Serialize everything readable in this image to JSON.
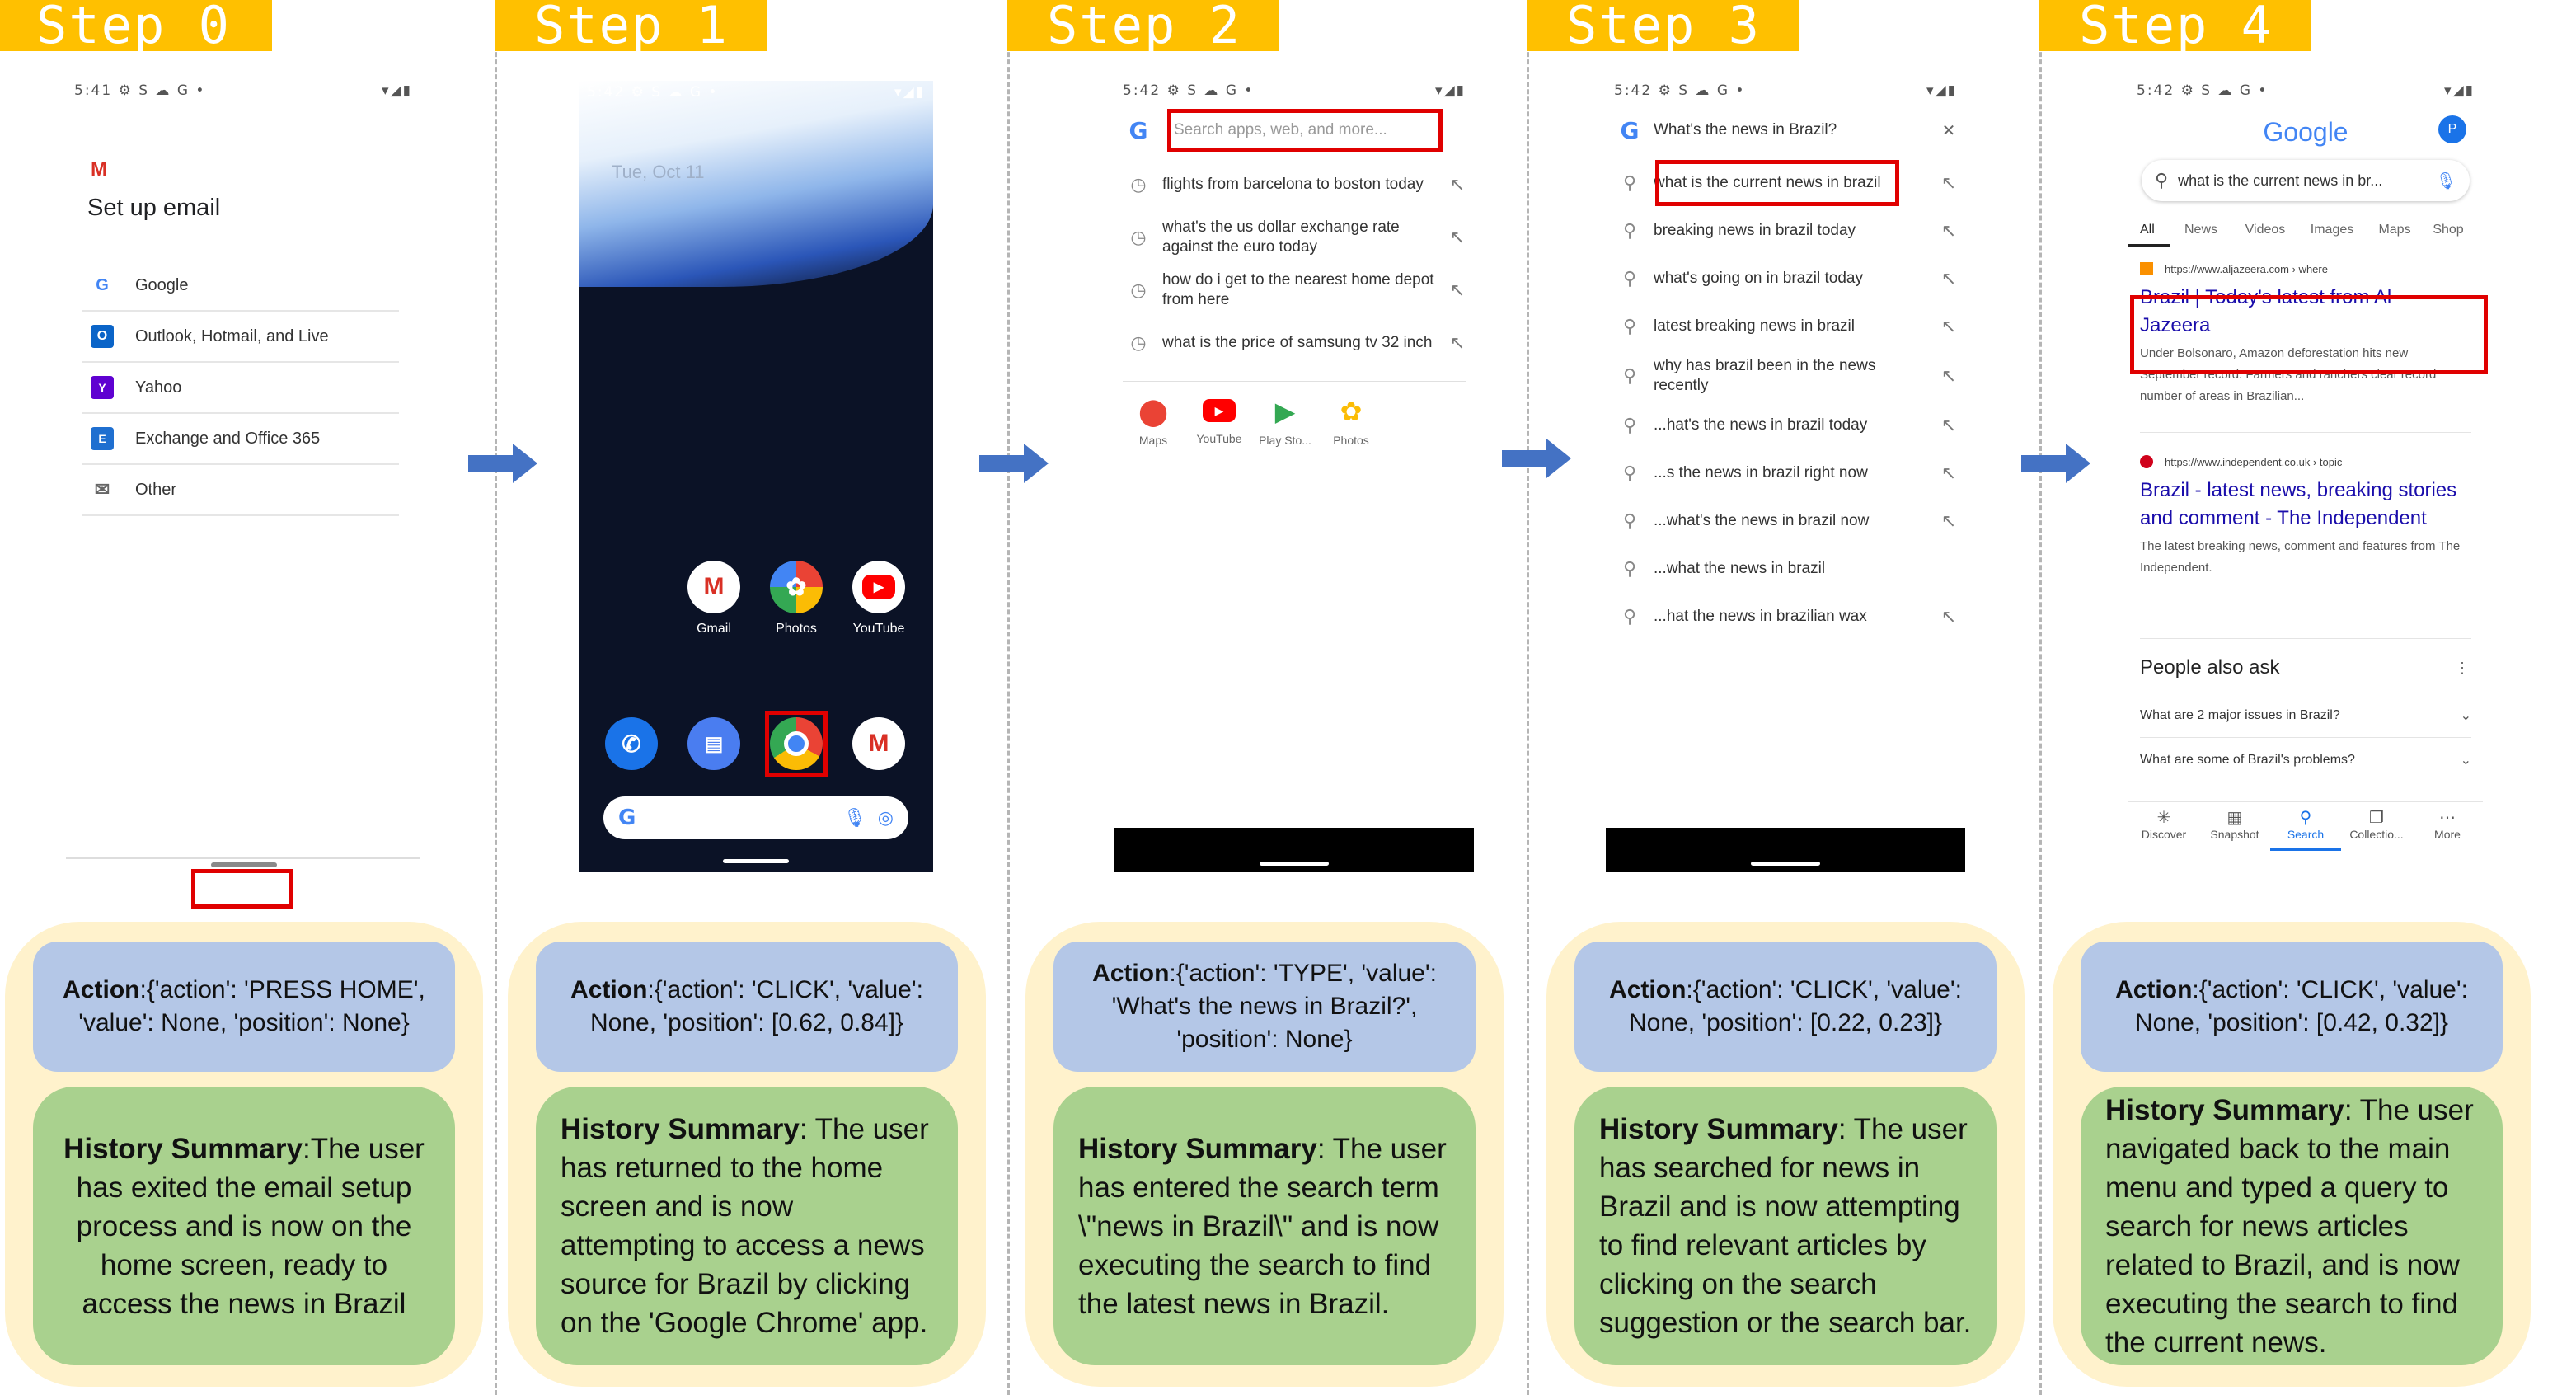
{
  "steps": [
    {
      "label": "Step 0",
      "action_label": "Action",
      "action_value": ":{'action': 'PRESS HOME', 'value': None, 'position': None}",
      "summary_label": "History Summary",
      "summary_value": ":The user has exited the email setup process and is now on the home screen, ready to access the news in Brazil"
    },
    {
      "label": "Step 1",
      "action_label": "Action",
      "action_value": ":{'action': 'CLICK', 'value': None, 'position': [0.62, 0.84]}",
      "summary_label": "History Summary",
      "summary_value": ": The user has returned to the home screen and is now attempting to access a news source for Brazil by clicking on the 'Google Chrome' app."
    },
    {
      "label": "Step 2",
      "action_label": "Action",
      "action_value": ":{'action': 'TYPE', 'value': 'What's the news in Brazil?', 'position': None}",
      "summary_label": "History Summary",
      "summary_value": ": The user has entered the search term \\\"news in Brazil\\\" and is now executing the search to find the latest news in Brazil."
    },
    {
      "label": "Step 3",
      "action_label": "Action",
      "action_value": ":{'action': 'CLICK', 'value': None, 'position': [0.22, 0.23]}",
      "summary_label": "History Summary",
      "summary_value": ": The user has searched for news in Brazil and is now attempting to find relevant articles by clicking on the search suggestion or the search bar."
    },
    {
      "label": "Step 4",
      "action_label": "Action",
      "action_value": ":{'action': 'CLICK', 'value': None, 'position': [0.42, 0.32]}",
      "summary_label": "History Summary",
      "summary_value": ": The user navigated back to the main menu and typed a query to search for news articles related to Brazil, and is now executing the search to find the current news."
    }
  ],
  "screen0": {
    "time": "5:41",
    "title": "Set up email",
    "options": [
      "Google",
      "Outlook, Hotmail, and Live",
      "Yahoo",
      "Exchange and Office 365",
      "Other"
    ]
  },
  "screen1": {
    "time": "5:42",
    "date": "Tue, Oct 11",
    "apps": [
      "Gmail",
      "Photos",
      "YouTube"
    ]
  },
  "screen2": {
    "time": "5:42",
    "search_placeholder": "Search apps, web, and more...",
    "suggestions": [
      "flights from barcelona to boston today",
      "what's the us dollar exchange rate against the euro today",
      "how do i get to the nearest home depot from here",
      "what is the price of samsung tv 32 inch"
    ],
    "apps": [
      "Maps",
      "YouTube",
      "Play Sto...",
      "Photos"
    ]
  },
  "screen3": {
    "time": "5:42",
    "query": "What's the news in Brazil?",
    "suggestions": [
      "what is the current news in brazil",
      "breaking news in brazil today",
      "what's going on in brazil today",
      "latest breaking news in brazil",
      "why has brazil been in the news recently",
      "...hat's the news in brazil today",
      "...s the news in brazil right now",
      "...what's the news in brazil now",
      "...what the news in brazil",
      "...hat the news in brazilian wax"
    ]
  },
  "screen4": {
    "time": "5:42",
    "logo": "Google",
    "avatar": "P",
    "query": "what is the current news in br...",
    "tabs": [
      "All",
      "News",
      "Videos",
      "Images",
      "Maps",
      "Shop"
    ],
    "result1": {
      "url": "https://www.aljazeera.com › where",
      "title": "Brazil | Today's latest from Al Jazeera",
      "snippet": "Under Bolsonaro, Amazon deforestation hits new September record. Farmers and ranchers clear record number of areas in Brazilian..."
    },
    "result2": {
      "url": "https://www.independent.co.uk › topic",
      "title": "Brazil - latest news, breaking stories and comment - The Independent",
      "snippet": "The latest breaking news, comment and features from The Independent."
    },
    "paa_title": "People also ask",
    "paa": [
      "What are 2 major issues in Brazil?",
      "What are some of Brazil's problems?"
    ],
    "bottom_nav": [
      "Discover",
      "Snapshot",
      "Search",
      "Collectio...",
      "More"
    ]
  },
  "colors": {
    "step_label_bg": "#ffc000",
    "card_bg": "#fff2cc",
    "action_bg": "#b4c7e7",
    "summary_bg": "#a9d18e",
    "highlight": "#e00000",
    "arrow": "#4472c4",
    "link_blue": "#1a0dab"
  }
}
